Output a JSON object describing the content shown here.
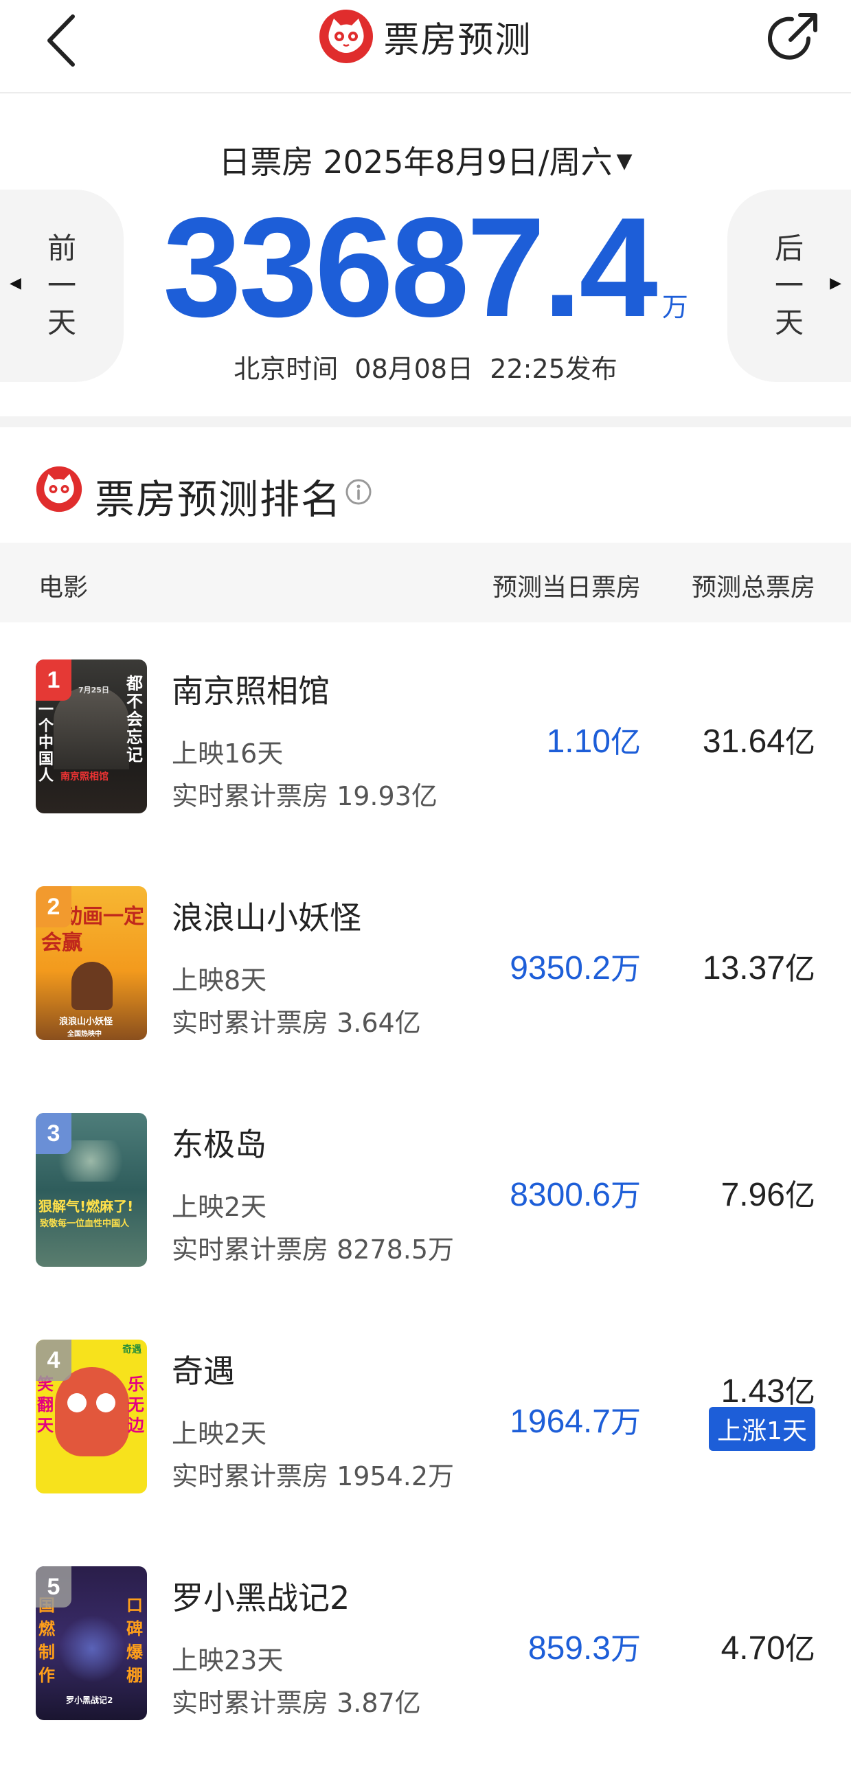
{
  "nav": {
    "title": "票房预测",
    "logo_icon": "maoyan-cat-logo",
    "back_icon": "chevron-left-icon",
    "share_icon": "share-arrow-icon"
  },
  "summary": {
    "date_label": "日票房",
    "date_value": "2025年8月9日/周六",
    "date_dropdown_icon": "triangle-down-icon",
    "prev_day": [
      "前",
      "一",
      "天"
    ],
    "next_day": [
      "后",
      "一",
      "天"
    ],
    "total_value": "33687.4",
    "total_unit": "万",
    "publish_prefix": "北京时间",
    "publish_date": "08月08日",
    "publish_time": "22:25发布"
  },
  "ranking": {
    "title": "票房预测排名",
    "info_icon": "info-circle-icon",
    "col_movie": "电影",
    "col_today": "预测当日票房",
    "col_total": "预测总票房"
  },
  "movies": [
    {
      "rank": "1",
      "title": "南京照相馆",
      "days": "上映16天",
      "cumulative": "实时累计票房 19.93亿",
      "today_num": "1.10",
      "today_unit": "亿",
      "total_num": "31.64",
      "total_unit": "亿",
      "badge": ""
    },
    {
      "rank": "2",
      "title": "浪浪山小妖怪",
      "days": "上映8天",
      "cumulative": "实时累计票房 3.64亿",
      "today_num": "9350.2",
      "today_unit": "万",
      "total_num": "13.37",
      "total_unit": "亿",
      "badge": ""
    },
    {
      "rank": "3",
      "title": "东极岛",
      "days": "上映2天",
      "cumulative": "实时累计票房 8278.5万",
      "today_num": "8300.6",
      "today_unit": "万",
      "total_num": "7.96",
      "total_unit": "亿",
      "badge": ""
    },
    {
      "rank": "4",
      "title": "奇遇",
      "days": "上映2天",
      "cumulative": "实时累计票房 1954.2万",
      "today_num": "1964.7",
      "today_unit": "万",
      "total_num": "1.43",
      "total_unit": "亿",
      "badge": "上涨1天"
    },
    {
      "rank": "5",
      "title": "罗小黑战记2",
      "days": "上映23天",
      "cumulative": "实时累计票房 3.87亿",
      "today_num": "859.3",
      "today_unit": "万",
      "total_num": "4.70",
      "total_unit": "亿",
      "badge": ""
    }
  ],
  "posters": [
    {
      "text_right": "都不会忘记",
      "text_left": "一个中国人",
      "text_bottom": "南京照相馆",
      "text_top": "7月25日"
    },
    {
      "text_top": "国动画一定会赢",
      "text_bottom": "浪浪山小妖怪",
      "text_small": "全国热映中"
    },
    {
      "text_mid": "狠解气!燃麻了!",
      "text_sub": "致敬每一位血性中国人"
    },
    {
      "text_left": "笑翻天",
      "text_right": "乐无边",
      "text_top": "奇遇"
    },
    {
      "text_left": "国燃制作",
      "text_right": "口碑爆棚",
      "text_bottom": "罗小黑战记2"
    }
  ],
  "colors": {
    "accent_blue": "#1d5ed8",
    "brand_red": "#e02d2d",
    "rank1": "#e53935",
    "rank2": "#f29a2e",
    "rank3": "#6a8fd6",
    "rank_other": "#9a9a9a"
  }
}
